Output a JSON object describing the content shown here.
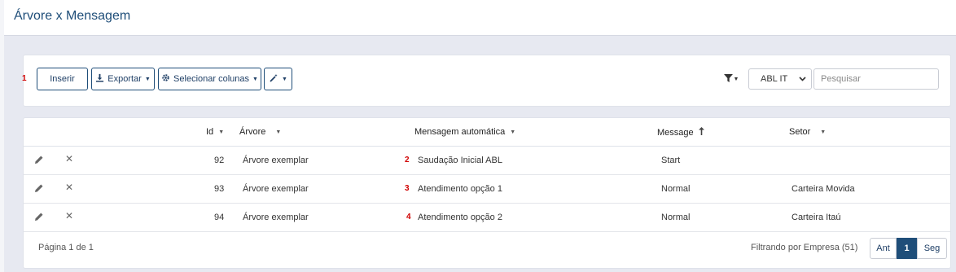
{
  "page": {
    "title": "Árvore x Mensagem"
  },
  "toolbar": {
    "marker": "1",
    "insert_label": "Inserir",
    "export_label": "Exportar",
    "columns_label": "Selecionar colunas",
    "company_select_value": "ABL IT",
    "search_placeholder": "Pesquisar"
  },
  "table": {
    "headers": {
      "id": "Id",
      "tree": "Árvore",
      "auto_message": "Mensagem automática",
      "message": "Message",
      "sector": "Setor"
    },
    "rows": [
      {
        "marker": "2",
        "id": "92",
        "tree": "Árvore exemplar",
        "auto_message": "Saudação Inicial ABL",
        "message": "Start",
        "sector": ""
      },
      {
        "marker": "3",
        "id": "93",
        "tree": "Árvore exemplar",
        "auto_message": "Atendimento opção 1",
        "message": "Normal",
        "sector": "Carteira Movida"
      },
      {
        "marker": "4",
        "id": "94",
        "tree": "Árvore exemplar",
        "auto_message": "Atendimento opção 2",
        "message": "Normal",
        "sector": "Carteira Itaú"
      }
    ]
  },
  "footer": {
    "page_info": "Página 1 de 1",
    "filter_info": "Filtrando por Empresa (51)",
    "prev_label": "Ant",
    "current_page": "1",
    "next_label": "Seg"
  },
  "colors": {
    "accent": "#1f4e79",
    "marker": "#d00000"
  }
}
